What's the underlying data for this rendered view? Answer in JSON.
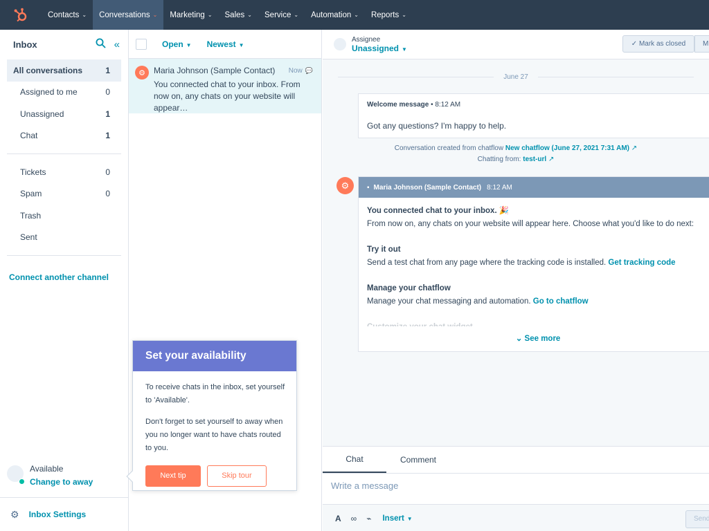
{
  "nav": {
    "items": [
      {
        "label": "Contacts",
        "active": false
      },
      {
        "label": "Conversations",
        "active": true
      },
      {
        "label": "Marketing",
        "active": false
      },
      {
        "label": "Sales",
        "active": false
      },
      {
        "label": "Service",
        "active": false
      },
      {
        "label": "Automation",
        "active": false
      },
      {
        "label": "Reports",
        "active": false
      }
    ],
    "brand_color": "#ff7a59"
  },
  "sidebar": {
    "title": "Inbox",
    "items": [
      {
        "label": "All conversations",
        "count": "1"
      },
      {
        "label": "Assigned to me",
        "count": "0"
      },
      {
        "label": "Unassigned",
        "count": "1"
      },
      {
        "label": "Chat",
        "count": "1"
      }
    ],
    "items2": [
      {
        "label": "Tickets",
        "count": "0"
      },
      {
        "label": "Spam",
        "count": "0"
      },
      {
        "label": "Trash",
        "count": ""
      },
      {
        "label": "Sent",
        "count": ""
      }
    ],
    "connect": "Connect another channel",
    "status": "Available",
    "change": "Change to away",
    "settings": "Inbox Settings"
  },
  "list": {
    "filter": "Open",
    "sort": "Newest",
    "conversation": {
      "name": "Maria Johnson (Sample Contact)",
      "time": "Now",
      "preview": "You connected chat to your inbox. From now on, any chats on your website will appear…"
    }
  },
  "popover": {
    "title": "Set your availability",
    "p1": "To receive chats in the inbox, set yourself to 'Available'.",
    "p2": "Don't forget to set yourself to away when you no longer want to have chats routed to you.",
    "next": "Next tip",
    "skip": "Skip tour"
  },
  "thread": {
    "assignee_label": "Assignee",
    "assignee_value": "Unassigned",
    "mark_closed": "Mark as closed",
    "more": "M",
    "date": "June 27",
    "welcome_title": "Welcome message",
    "welcome_time": "• 8:12 AM",
    "welcome_msg": "Got any questions? I'm happy to help.",
    "meta1_prefix": "Conversation created from chatflow",
    "meta1_link": "New chatflow (June 27, 2021 7:31 AM)",
    "meta2_prefix": "Chatting from:",
    "meta2_link": "test-url",
    "bot_name": "Maria Johnson (Sample Contact)",
    "bot_time": "8:12 AM",
    "bot_l1": "You connected chat to your inbox. 🎉",
    "bot_l2": "From now on, any chats on your website will appear here. Choose what you'd like to do next:",
    "try_title": "Try it out",
    "try_text": "Send a test chat from any page where the tracking code is installed.",
    "try_link": "Get tracking code",
    "manage_title": "Manage your chatflow",
    "manage_text": "Manage your chat messaging and automation.",
    "manage_link": "Go to chatflow",
    "customize": "Customize your chat widget",
    "see_more": "See more"
  },
  "composer": {
    "tabs": [
      "Chat",
      "Comment"
    ],
    "placeholder": "Write a message",
    "insert": "Insert",
    "send": "Send"
  }
}
